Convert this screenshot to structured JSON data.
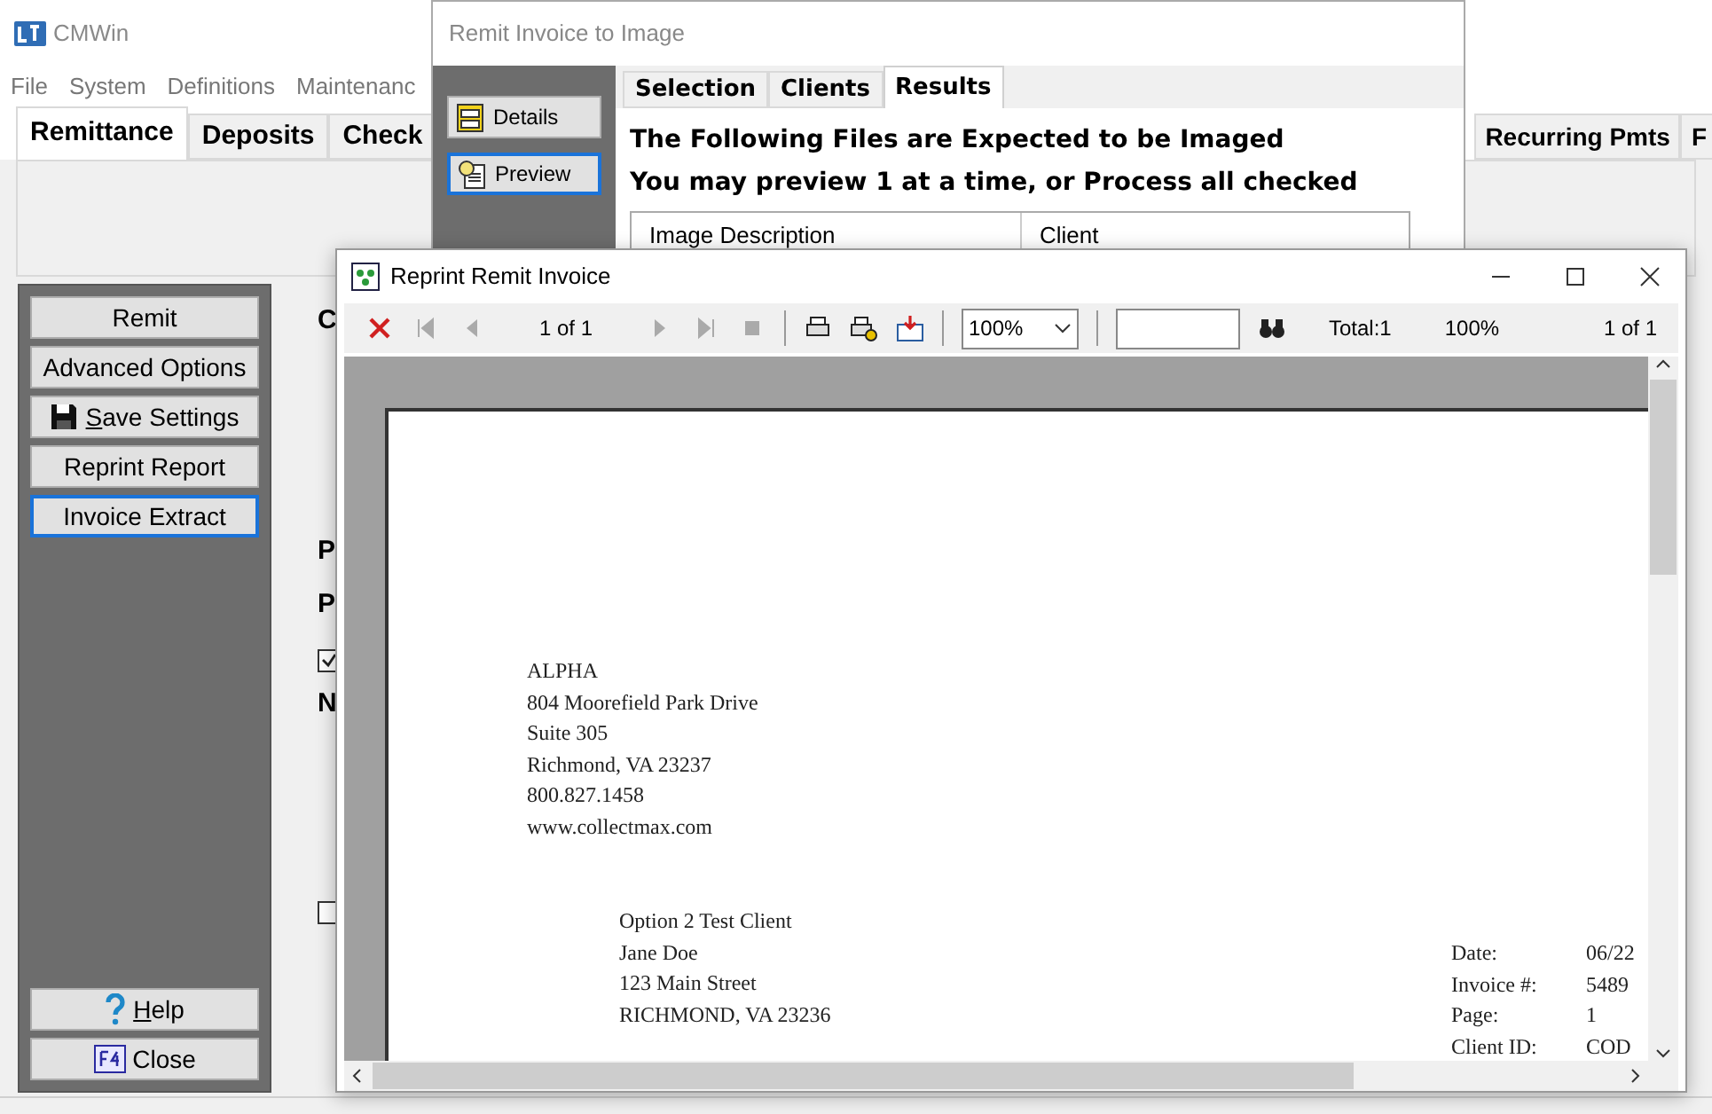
{
  "main_window": {
    "title": "CMWin",
    "menu": [
      "File",
      "System",
      "Definitions",
      "Maintenanc"
    ],
    "tabs": [
      {
        "label": "Remittance",
        "selected": true
      },
      {
        "label": "Deposits",
        "selected": false
      },
      {
        "label": "Check",
        "selected": false
      },
      {
        "label": "Recurring Pmts",
        "selected": false
      },
      {
        "label": "F",
        "selected": false
      }
    ],
    "sidebar_buttons": [
      {
        "label": "Remit",
        "kind": "plain",
        "underline_first": false,
        "focused": false
      },
      {
        "label": "Advanced Options",
        "kind": "plain",
        "underline_first": false,
        "focused": false
      },
      {
        "label": "Save Settings",
        "kind": "save",
        "underline_first": true,
        "focused": false
      },
      {
        "label": "Reprint Report",
        "kind": "plain",
        "underline_first": false,
        "focused": false
      },
      {
        "label": "Invoice Extract",
        "kind": "plain",
        "underline_first": false,
        "focused": true
      }
    ],
    "sidebar_bottom_buttons": [
      {
        "label": "Help",
        "kind": "help",
        "underline_first": true,
        "focused": false
      },
      {
        "label": "Close",
        "kind": "close",
        "underline_first": false,
        "focused": false
      }
    ],
    "form_labels": [
      "C",
      "P",
      "P",
      "N"
    ],
    "checkboxes": [
      {
        "checked": true
      },
      {
        "checked": false
      }
    ]
  },
  "image_dialog": {
    "title": "Remit Invoice to Image",
    "side_buttons": [
      {
        "label": "Details",
        "kind": "details",
        "focused": false
      },
      {
        "label": "Preview",
        "kind": "preview",
        "focused": true
      }
    ],
    "tabs": [
      {
        "label": "Selection",
        "selected": false
      },
      {
        "label": "Clients",
        "selected": false
      },
      {
        "label": "Results",
        "selected": true
      }
    ],
    "headings": [
      "The Following Files are Expected to be Imaged",
      "You may preview 1 at a time, or Process all checked"
    ],
    "table": {
      "columns": [
        "Image Description",
        "Client"
      ]
    }
  },
  "reprint_window": {
    "title": "Reprint Remit Invoice",
    "toolbar": {
      "page": "1 of 1",
      "zoom": "100%",
      "total": "Total:1",
      "zoom_readout": "100%",
      "page_readout": "1 of 1"
    },
    "document": {
      "sender": [
        "ALPHA",
        "804 Moorefield Park Drive",
        "Suite 305",
        "Richmond, VA 23237",
        "800.827.1458",
        "www.collectmax.com"
      ],
      "recipient": [
        "Option 2 Test Client",
        "Jane Doe",
        "123 Main Street",
        "RICHMOND, VA 23236"
      ],
      "details": [
        {
          "label": "Date:",
          "value": "06/22"
        },
        {
          "label": "Invoice #:",
          "value": "5489"
        },
        {
          "label": "Page:",
          "value": "1"
        },
        {
          "label": "Client ID:",
          "value": "COD"
        }
      ]
    }
  }
}
